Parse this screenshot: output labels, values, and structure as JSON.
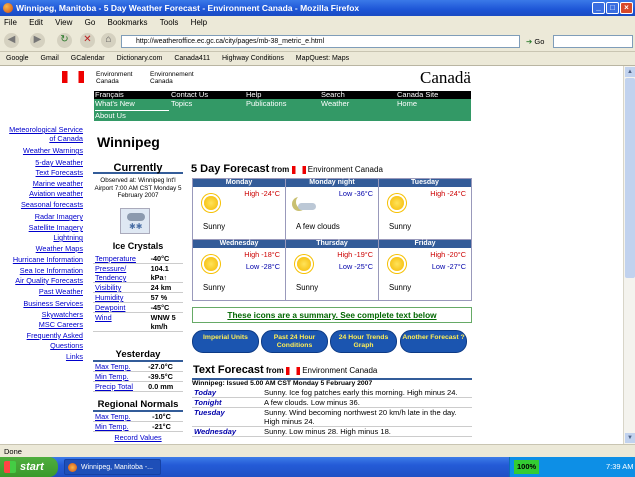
{
  "window": {
    "title": "Winnipeg, Manitoba - 5 Day Weather Forecast - Environment Canada - Mozilla Firefox"
  },
  "menu": [
    "File",
    "Edit",
    "View",
    "Go",
    "Bookmarks",
    "Tools",
    "Help"
  ],
  "url": "http://weatheroffice.ec.gc.ca/city/pages/mb-38_metric_e.html",
  "go_label": "Go",
  "bookmarks": [
    "Google",
    "Gmail",
    "GCalendar",
    "Dictionary.com",
    "Canada411",
    "Highway Conditions",
    "MapQuest: Maps"
  ],
  "header": {
    "env_en": "Environment",
    "canada_en": "Canada",
    "env_fr": "Environnement",
    "canada_fr": "Canada",
    "wordmark": "Canadä"
  },
  "topnav": {
    "row1": [
      "Français",
      "Contact Us",
      "Help",
      "Search",
      "Canada Site"
    ],
    "row2": [
      "What's New",
      "Topics",
      "Publications",
      "Weather",
      "Home"
    ],
    "row3": "About Us"
  },
  "leftnav": [
    "Meteorological Service",
    "of Canada",
    "Weather Warnings",
    "5-day Weather",
    "Text Forecasts",
    "Marine weather",
    "Aviation weather",
    "Seasonal forecasts",
    "Radar Imagery",
    "Satellite Imagery",
    "Lightning",
    "Weather Maps",
    "Hurricane Information",
    "Sea Ice Information",
    "Air Quality Forecasts",
    "Past Weather",
    "Business Services",
    "Skywatchers",
    "MSC Careers",
    "Frequently Asked",
    "Questions",
    "Links"
  ],
  "city": "Winnipeg",
  "current": {
    "title": "Currently",
    "observed": "Observed at: Winnipeg Int'l Airport 7:00 AM CST Monday 5 February 2007",
    "condition": "Ice Crystals",
    "rows": [
      [
        "Temperature",
        "-40°C"
      ],
      [
        "Pressure/ Tendency",
        "104.1 kPa↑"
      ],
      [
        "Visibility",
        "24 km"
      ],
      [
        "Humidity",
        "57 %"
      ],
      [
        "Dewpoint",
        "-45°C"
      ],
      [
        "Wind",
        "WNW 5 km/h"
      ]
    ]
  },
  "yesterday": {
    "title": "Yesterday",
    "rows": [
      [
        "Max Temp.",
        "-27.0°C"
      ],
      [
        "Min Temp.",
        "-39.5°C"
      ],
      [
        "Precip Total",
        "0.0 mm"
      ]
    ]
  },
  "regional": {
    "title": "Regional Normals",
    "rows": [
      [
        "Max Temp.",
        "-10°C"
      ],
      [
        "Min Temp.",
        "-21°C"
      ]
    ],
    "link": "Record Values"
  },
  "forecast": {
    "title": "5 Day Forecast",
    "from": "from",
    "source": "Environment Canada",
    "days": [
      {
        "name": "Monday",
        "temp1": "High -24°C",
        "temp2": "",
        "desc": "Sunny",
        "icon": "sun-icon"
      },
      {
        "name": "Monday night",
        "temp1": "Low -36°C",
        "temp2": "",
        "desc": "A few clouds",
        "icon": "moon-cloud-icon"
      },
      {
        "name": "Tuesday",
        "temp1": "High -24°C",
        "temp2": "",
        "desc": "Sunny",
        "icon": "sun-icon"
      },
      {
        "name": "Wednesday",
        "temp1": "High -18°C",
        "temp2": "Low -28°C",
        "desc": "Sunny",
        "icon": "sun-icon"
      },
      {
        "name": "Thursday",
        "temp1": "High -19°C",
        "temp2": "Low -25°C",
        "desc": "Sunny",
        "icon": "sun-icon"
      },
      {
        "name": "Friday",
        "temp1": "High -20°C",
        "temp2": "Low -27°C",
        "desc": "Sunny",
        "icon": "sun-icon"
      }
    ],
    "summary": "These icons are a summary. See complete text below"
  },
  "buttons": [
    "Imperial Units",
    "Past 24 Hour Conditions",
    "24 Hour Trends Graph",
    "Another Forecast ?"
  ],
  "text_forecast": {
    "title": "Text Forecast",
    "from": "from",
    "source": "Environment Canada",
    "issued": "Winnipeg: Issued 5.00 AM CST Monday 5 February 2007",
    "rows": [
      [
        "Today",
        "Sunny. Ice fog patches early this morning. High minus 24."
      ],
      [
        "Tonight",
        "A few clouds. Low minus 36."
      ],
      [
        "Tuesday",
        "Sunny. Wind becoming northwest 20 km/h late in the day. High minus 24."
      ],
      [
        "Wednesday",
        "Sunny. Low minus 28. High minus 18."
      ]
    ]
  },
  "status": "Done",
  "taskbar": {
    "start": "start",
    "item": "Winnipeg, Manitoba -...",
    "zoom": "100%",
    "clock": "7:39 AM"
  }
}
